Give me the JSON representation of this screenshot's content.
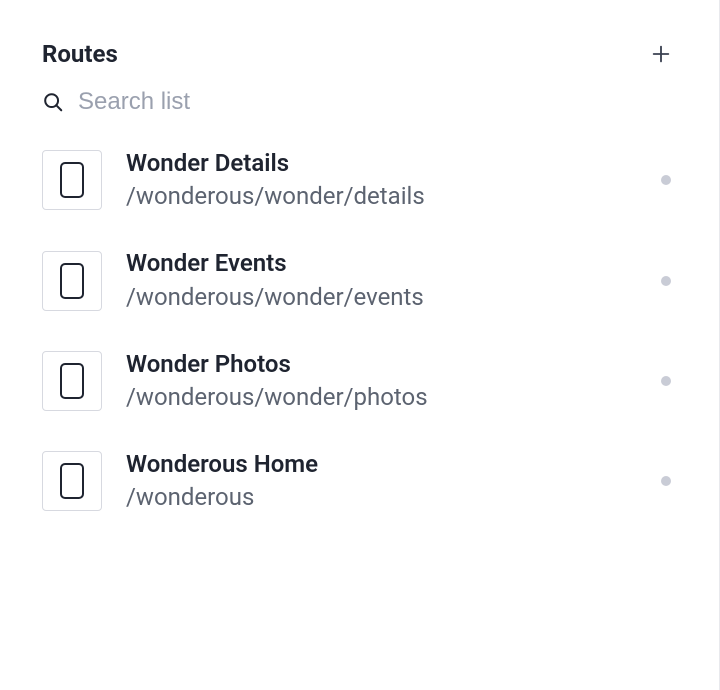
{
  "header": {
    "title": "Routes"
  },
  "search": {
    "placeholder": "Search list",
    "value": ""
  },
  "routes": [
    {
      "title": "Wonder Details",
      "path": "/wonderous/wonder/details"
    },
    {
      "title": "Wonder Events",
      "path": "/wonderous/wonder/events"
    },
    {
      "title": "Wonder Photos",
      "path": "/wonderous/wonder/photos"
    },
    {
      "title": "Wonderous Home",
      "path": "/wonderous"
    }
  ]
}
